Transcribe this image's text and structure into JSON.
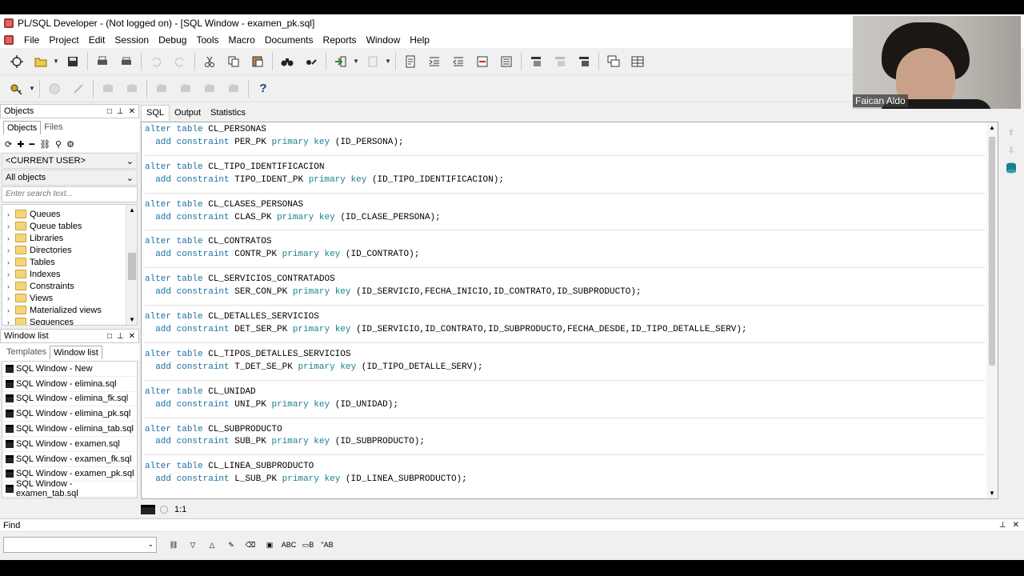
{
  "window": {
    "title": "PL/SQL Developer - (Not logged on) - [SQL Window - examen_pk.sql]"
  },
  "menu": [
    "File",
    "Project",
    "Edit",
    "Session",
    "Debug",
    "Tools",
    "Macro",
    "Documents",
    "Reports",
    "Window",
    "Help"
  ],
  "objects_panel": {
    "title": "Objects",
    "tabs": [
      "Objects",
      "Files"
    ],
    "user_combo": "<CURRENT USER>",
    "filter_combo": "All objects",
    "search_placeholder": "Enter search text...",
    "tree_items": [
      "Queues",
      "Queue tables",
      "Libraries",
      "Directories",
      "Tables",
      "Indexes",
      "Constraints",
      "Views",
      "Materialized views",
      "Sequences"
    ]
  },
  "window_list_panel": {
    "title": "Window list",
    "tabs": [
      "Templates",
      "Window list"
    ],
    "items": [
      "SQL Window - New",
      "SQL Window - elimina.sql",
      "SQL Window - elimina_fk.sql",
      "SQL Window - elimina_pk.sql",
      "SQL Window - elimina_tab.sql",
      "SQL Window - examen.sql",
      "SQL Window - examen_fk.sql",
      "SQL Window - examen_pk.sql",
      "SQL Window - examen_tab.sql"
    ]
  },
  "editor": {
    "tabs": [
      "SQL",
      "Output",
      "Statistics"
    ],
    "statements": [
      {
        "table": "CL_PERSONAS",
        "constraint": "PER_PK",
        "cols": "(ID_PERSONA);"
      },
      {
        "table": "CL_TIPO_IDENTIFICACION",
        "constraint": "TIPO_IDENT_PK",
        "cols": "(ID_TIPO_IDENTIFICACION);"
      },
      {
        "table": "CL_CLASES_PERSONAS",
        "constraint": "CLAS_PK",
        "cols": "(ID_CLASE_PERSONA);"
      },
      {
        "table": "CL_CONTRATOS",
        "constraint": "CONTR_PK",
        "cols": "(ID_CONTRATO);"
      },
      {
        "table": "CL_SERVICIOS_CONTRATADOS",
        "constraint": "SER_CON_PK",
        "cols": "(ID_SERVICIO,FECHA_INICIO,ID_CONTRATO,ID_SUBPRODUCTO);"
      },
      {
        "table": "CL_DETALLES_SERVICIOS",
        "constraint": "DET_SER_PK",
        "cols": "(ID_SERVICIO,ID_CONTRATO,ID_SUBPRODUCTO,FECHA_DESDE,ID_TIPO_DETALLE_SERV);"
      },
      {
        "table": "CL_TIPOS_DETALLES_SERVICIOS",
        "constraint": "T_DET_SE_PK",
        "cols": "(ID_TIPO_DETALLE_SERV);"
      },
      {
        "table": "CL_UNIDAD",
        "constraint": "UNI_PK",
        "cols": "(ID_UNIDAD);"
      },
      {
        "table": "CL_SUBPRODUCTO",
        "constraint": "SUB_PK",
        "cols": "(ID_SUBPRODUCTO);"
      },
      {
        "table": "CL_LINEA_SUBPRODUCTO",
        "constraint": "L_SUB_PK",
        "cols": "(ID_LINEA_SUBPRODUCTO);"
      }
    ],
    "keywords": {
      "alter": "alter",
      "table": "table",
      "add": "add",
      "constraint": "constraint",
      "primary": "primary",
      "key": "key"
    }
  },
  "status": {
    "position": "1:1"
  },
  "find_panel": {
    "title": "Find",
    "input_value": ""
  },
  "webcam": {
    "name": "Faican Aldo"
  },
  "colors": {
    "keyword": "#1a6fa0",
    "keyword2": "#1a7f8e",
    "background": "#f0f0f0"
  }
}
